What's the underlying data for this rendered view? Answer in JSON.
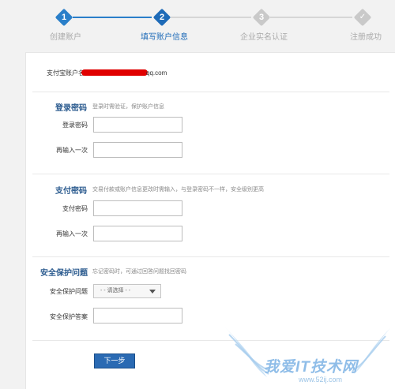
{
  "steps": [
    {
      "number": "1",
      "label": "创建账户",
      "state": "done"
    },
    {
      "number": "2",
      "label": "填写账户信息",
      "state": "current"
    },
    {
      "number": "3",
      "label": "企业实名认证",
      "state": "todo"
    },
    {
      "number": "✓",
      "label": "注册成功",
      "state": "todo"
    }
  ],
  "account": {
    "label": "支付宝账户名",
    "value_suffix": "qq.com"
  },
  "sections": {
    "login": {
      "title": "登录密码",
      "hint": "登录时需验证，保护账户信息",
      "password_label": "登录密码",
      "confirm_label": "再输入一次"
    },
    "payment": {
      "title": "支付密码",
      "hint": "交易付款或账户信息更改时需输入，与登录密码不一样，安全级别更高",
      "password_label": "支付密码",
      "confirm_label": "再输入一次"
    },
    "security": {
      "title": "安全保护问题",
      "hint": "忘记密码时，可通过回答问题找回密码",
      "question_label": "安全保护问题",
      "question_value": "- - 请选择 - -",
      "answer_label": "安全保护答案"
    }
  },
  "next_button": "下一步",
  "watermark": {
    "text": "我爱IT技术网",
    "url": "www.52ij.com"
  },
  "colors": {
    "accent": "#2a7fc9",
    "section_title": "#2a5a8e",
    "inactive": "#c9c9c9",
    "redaction": "#e00000"
  }
}
